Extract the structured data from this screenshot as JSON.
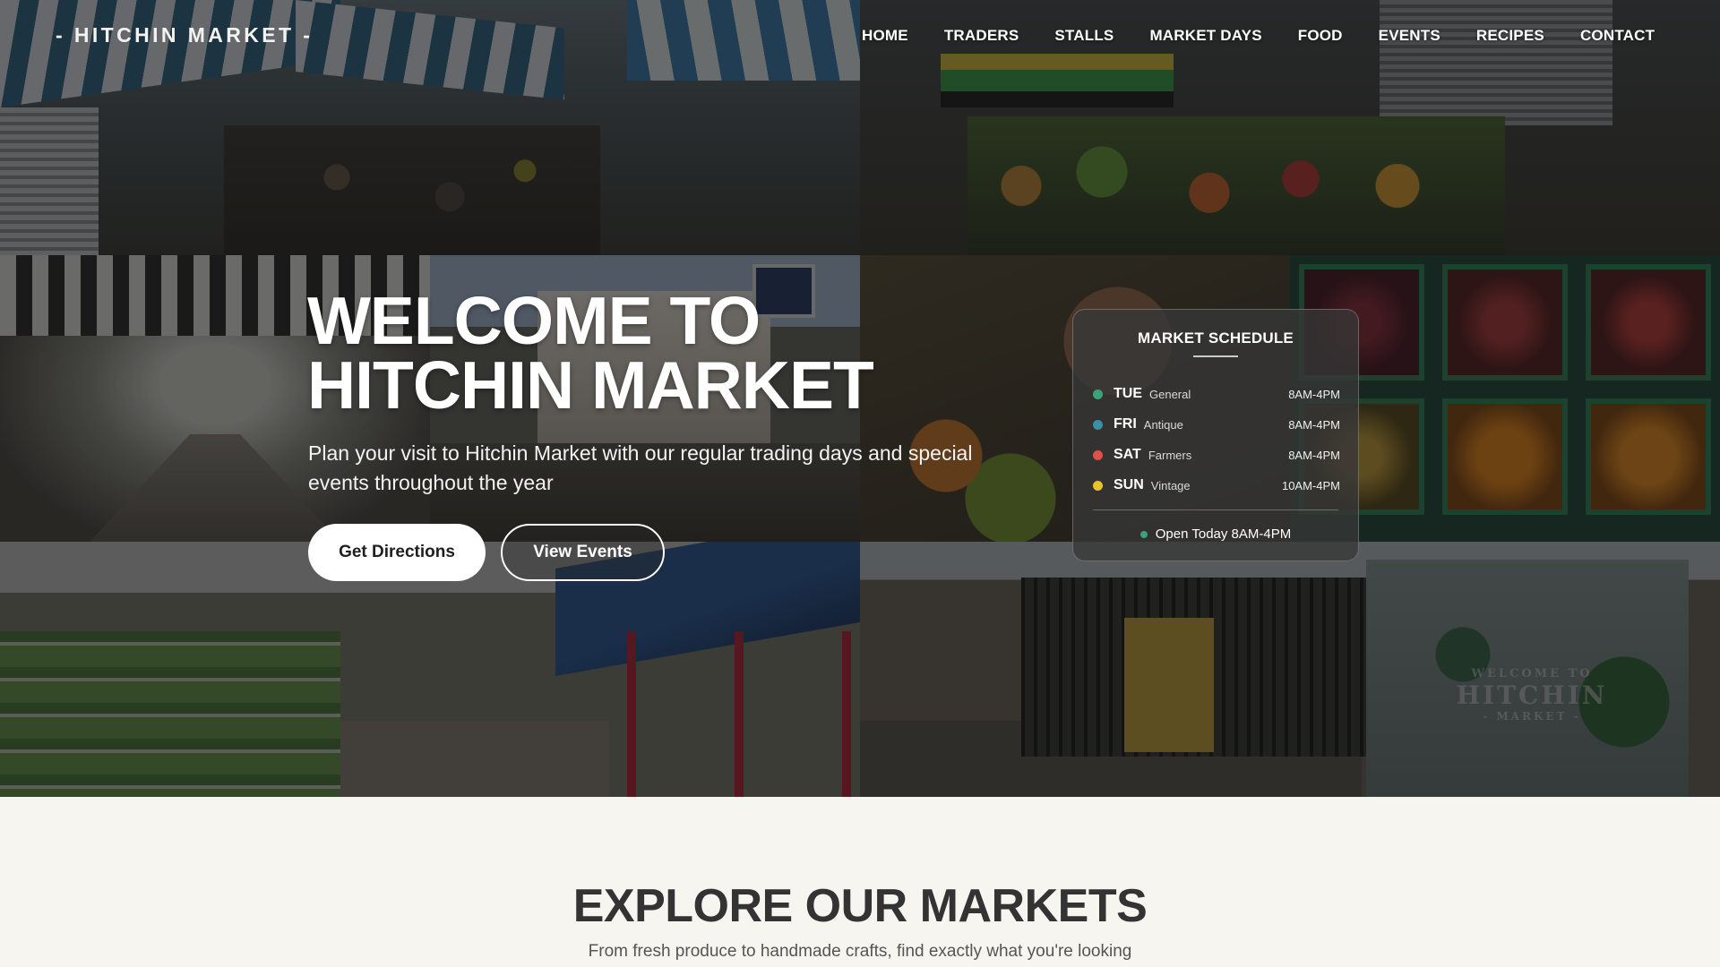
{
  "brand": {
    "name": "- HITCHIN MARKET -"
  },
  "nav": {
    "items": [
      "HOME",
      "TRADERS",
      "STALLS",
      "MARKET DAYS",
      "FOOD",
      "EVENTS",
      "RECIPES",
      "CONTACT"
    ]
  },
  "hero": {
    "title_line1": "WELCOME TO",
    "title_line2": "HITCHIN MARKET",
    "subtitle": "Plan your visit to Hitchin Market with our regular trading days and special events throughout the year",
    "primary_button": "Get Directions",
    "secondary_button": "View Events",
    "mural": {
      "line1": "WELCOME TO",
      "line2": "HITCHIN",
      "line3": "- MARKET -"
    }
  },
  "schedule": {
    "title": "MARKET SCHEDULE",
    "days": [
      {
        "day": "TUE",
        "type": "General",
        "hours": "8AM-4PM",
        "color": "#3aa37a"
      },
      {
        "day": "FRI",
        "type": "Antique",
        "hours": "8AM-4PM",
        "color": "#3a8fa8"
      },
      {
        "day": "SAT",
        "type": "Farmers",
        "hours": "8AM-4PM",
        "color": "#e0504a"
      },
      {
        "day": "SUN",
        "type": "Vintage",
        "hours": "10AM-4PM",
        "color": "#e8c22a"
      }
    ],
    "open_today": "Open Today 8AM-4PM",
    "open_color": "#3aa37a"
  },
  "explore": {
    "title": "EXPLORE OUR MARKETS",
    "subtitle": "From fresh produce to handmade crafts, find exactly what you're looking"
  }
}
